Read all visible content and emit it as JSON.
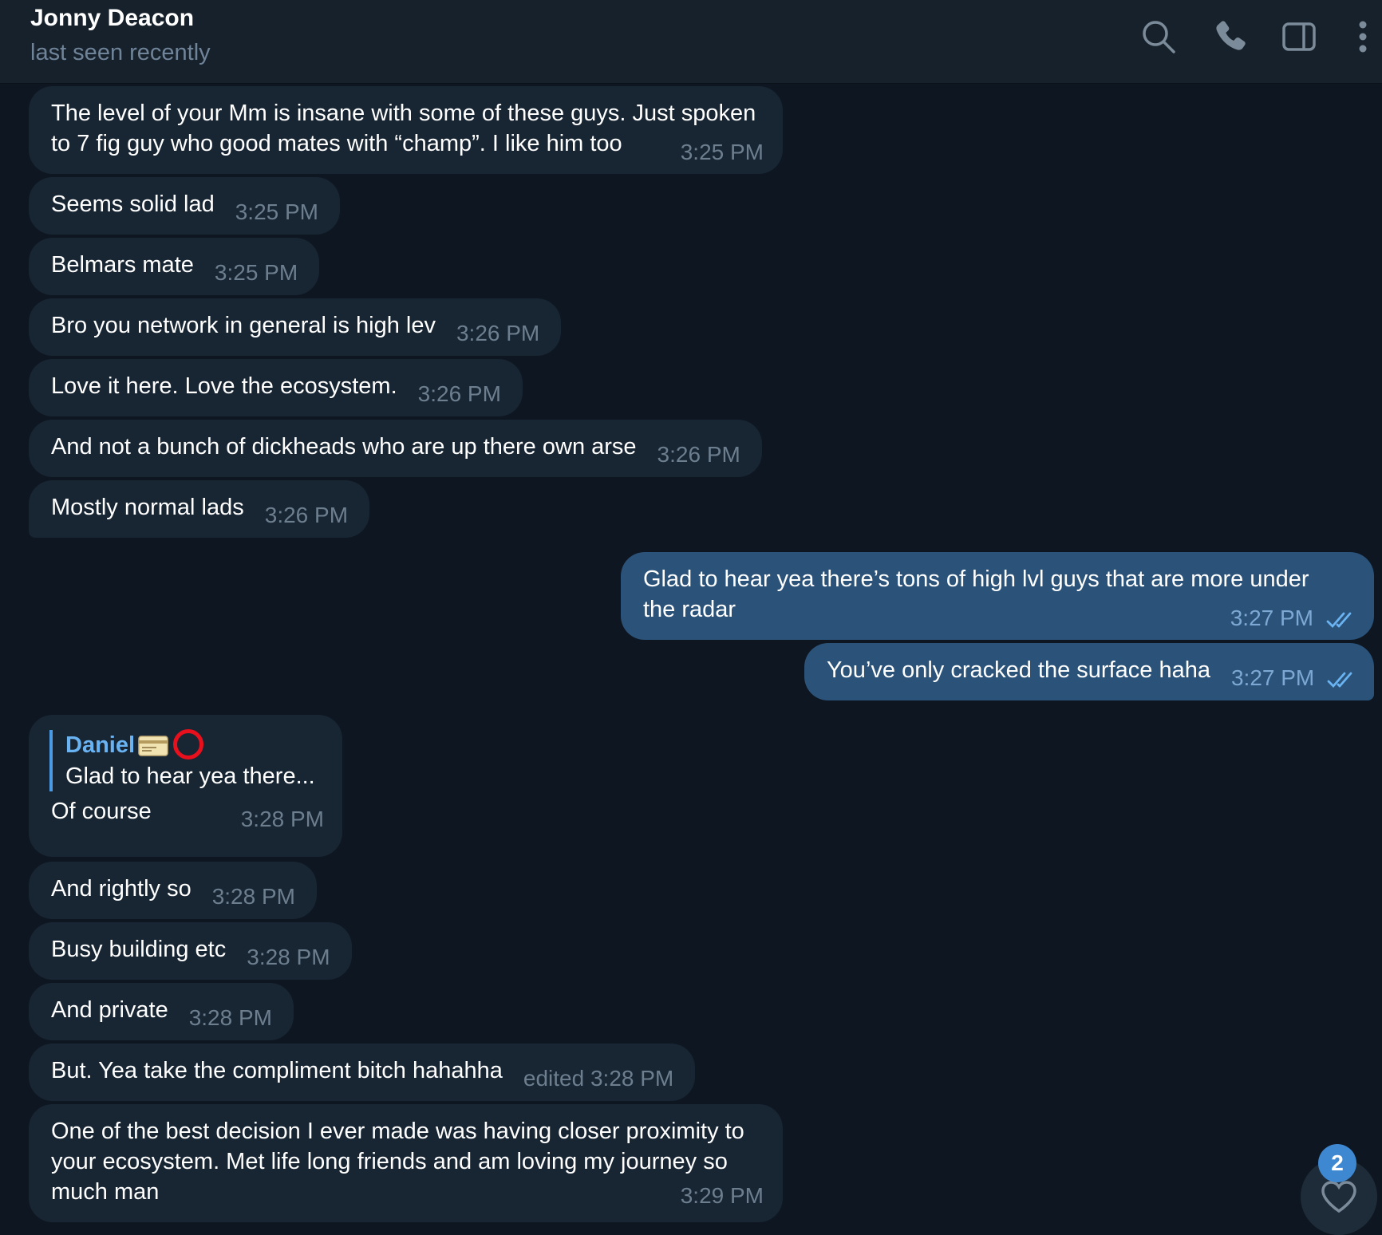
{
  "header": {
    "name": "Jonny Deacon",
    "status": "last seen recently",
    "icons": [
      "search-icon",
      "phone-icon",
      "sidebar-panel-icon",
      "more-vertical-icon"
    ]
  },
  "messages": [
    {
      "id": "m1",
      "dir": "in",
      "text": "The level of your Mm is insane with some of these guys. Just spoken\nto 7 fig guy who good mates with “champ”. I like him too",
      "time": "3:25 PM"
    },
    {
      "id": "m2",
      "dir": "in",
      "text": "Seems solid lad",
      "time": "3:25 PM"
    },
    {
      "id": "m3",
      "dir": "in",
      "text": "Belmars mate",
      "time": "3:25 PM"
    },
    {
      "id": "m4",
      "dir": "in",
      "text": "Bro you network in general is high lev",
      "time": "3:26 PM"
    },
    {
      "id": "m5",
      "dir": "in",
      "text": "Love it here. Love the ecosystem.",
      "time": "3:26 PM"
    },
    {
      "id": "m6",
      "dir": "in",
      "text": "And not a bunch of dickheads who are up there own arse",
      "time": "3:26 PM"
    },
    {
      "id": "m7",
      "dir": "in",
      "text": "Mostly normal lads",
      "time": "3:26 PM"
    },
    {
      "id": "m8",
      "dir": "out",
      "text": "Glad to hear yea there’s tons of high lvl guys that are more under\nthe radar",
      "time": "3:27 PM",
      "status": "read"
    },
    {
      "id": "m9",
      "dir": "out",
      "text": "You’ve only cracked the surface haha",
      "time": "3:27 PM",
      "status": "read"
    },
    {
      "id": "m10",
      "dir": "in",
      "reply": {
        "name": "Daniel",
        "text": "Glad to hear yea there...",
        "emojis": [
          "credit-card-emoji",
          "red-circle-emoji"
        ]
      },
      "text": "Of course",
      "time": "3:28 PM"
    },
    {
      "id": "m11",
      "dir": "in",
      "text": "And rightly so",
      "time": "3:28 PM"
    },
    {
      "id": "m12",
      "dir": "in",
      "text": "Busy building etc",
      "time": "3:28 PM"
    },
    {
      "id": "m13",
      "dir": "in",
      "text": "And private",
      "time": "3:28 PM"
    },
    {
      "id": "m14",
      "dir": "in",
      "text": "But. Yea take the compliment bitch hahahha",
      "time": "edited 3:28 PM"
    },
    {
      "id": "m15",
      "dir": "in",
      "text": "One of the best decision I ever made was having closer proximity to\nyour ecosystem. Met life long friends and am loving my journey so\nmuch man",
      "time": "3:29 PM"
    }
  ],
  "unread_reactions": {
    "count": "2",
    "icon": "heart-icon"
  },
  "colors": {
    "background": "#0e1621",
    "header": "#17212b",
    "incoming_bubble": "#182533",
    "outgoing_bubble": "#2b5278",
    "accent": "#6ab3f3",
    "badge": "#3e88d2"
  }
}
